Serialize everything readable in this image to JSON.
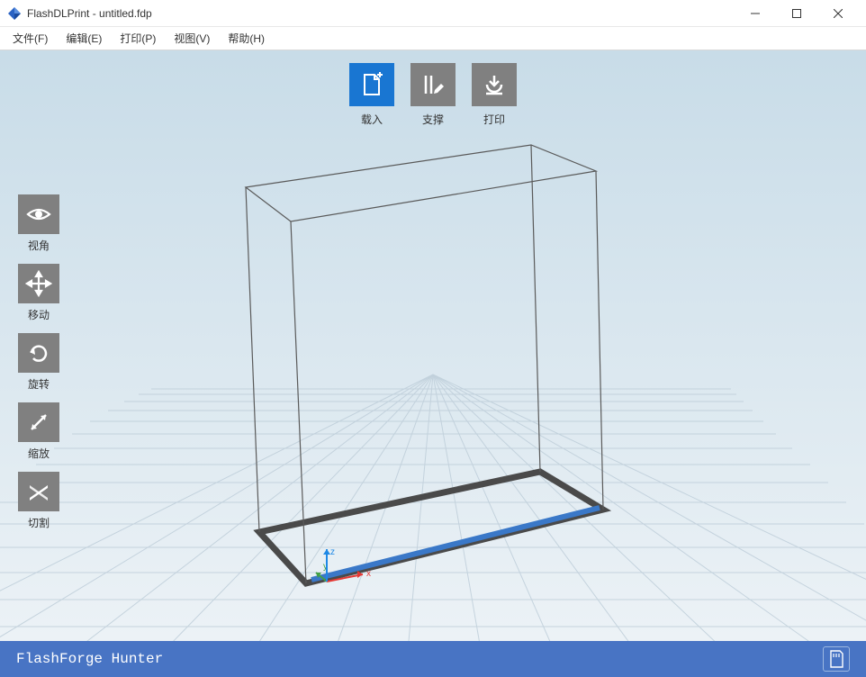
{
  "window": {
    "title": "FlashDLPrint - untitled.fdp"
  },
  "menubar": {
    "file": "文件(F)",
    "edit": "编辑(E)",
    "print": "打印(P)",
    "view": "视图(V)",
    "help": "帮助(H)"
  },
  "toptools": {
    "load": "载入",
    "support": "支撑",
    "print": "打印"
  },
  "lefttools": {
    "view": "视角",
    "move": "移动",
    "rotate": "旋转",
    "scale": "缩放",
    "cut": "切割"
  },
  "statusbar": {
    "printer": "FlashForge Hunter"
  },
  "axes": {
    "x": "x",
    "y": "y",
    "z": "z"
  },
  "colors": {
    "primary": "#1976d2",
    "toolgray": "#808080",
    "statusbar": "#4874c4",
    "axis_x": "#e53935",
    "axis_y": "#43a047",
    "axis_z": "#1e88e5"
  }
}
